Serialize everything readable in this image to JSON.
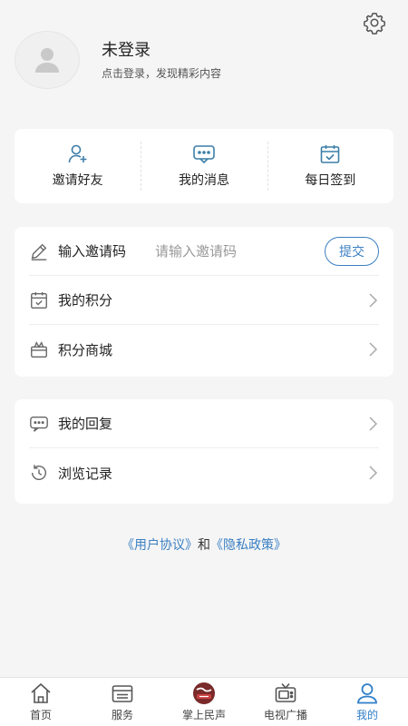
{
  "profile": {
    "name": "未登录",
    "subtitle": "点击登录，发现精彩内容"
  },
  "quick_actions": [
    {
      "label": "邀请好友",
      "icon": "add-user-icon"
    },
    {
      "label": "我的消息",
      "icon": "message-icon"
    },
    {
      "label": "每日签到",
      "icon": "calendar-check-icon"
    }
  ],
  "list1": {
    "invite": {
      "label": "输入邀请码",
      "placeholder": "请输入邀请码",
      "submit": "提交",
      "icon": "pencil-icon"
    },
    "points": {
      "label": "我的积分",
      "icon": "calendar-icon"
    },
    "mall": {
      "label": "积分商城",
      "icon": "gift-box-icon"
    }
  },
  "list2": {
    "replies": {
      "label": "我的回复",
      "icon": "chat-bubble-icon"
    },
    "history": {
      "label": "浏览记录",
      "icon": "history-clock-icon"
    }
  },
  "agreement": {
    "user_agreement": "《用户协议》",
    "and": "和",
    "privacy_policy": "《隐私政策》"
  },
  "tabbar": {
    "tabs": [
      {
        "label": "首页",
        "icon": "home-icon",
        "active": false
      },
      {
        "label": "服务",
        "icon": "service-list-icon",
        "active": false
      },
      {
        "label": "掌上民声",
        "icon": "minsheng-logo-icon",
        "active": false
      },
      {
        "label": "电视广播",
        "icon": "tv-icon",
        "active": false
      },
      {
        "label": "我的",
        "icon": "user-icon",
        "active": true
      }
    ]
  },
  "colors": {
    "accent": "#3a7fc2",
    "background": "#f5f5f5",
    "card": "#ffffff",
    "icon": "#3b7ea8"
  }
}
